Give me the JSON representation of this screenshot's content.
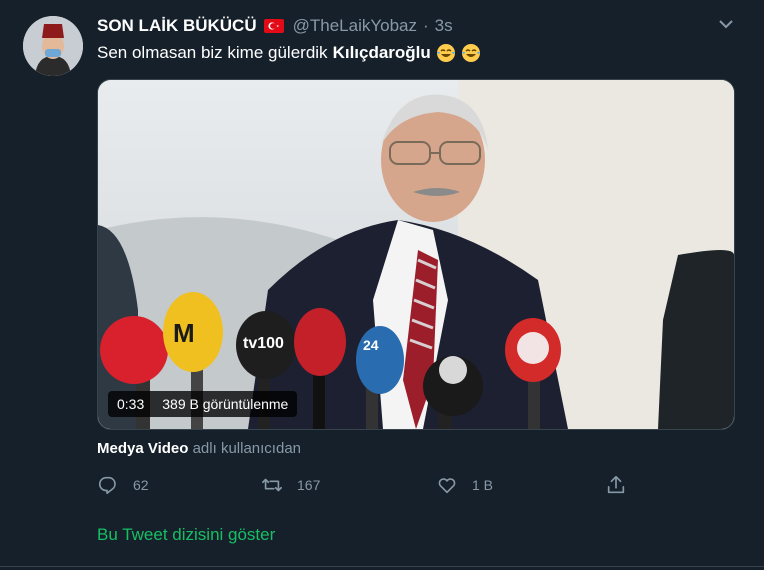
{
  "tweet": {
    "display_name": "SON LAİK BÜKÜCÜ",
    "flag_icon": "turkey-flag-emoji",
    "handle": "@TheLaikYobaz",
    "separator": "·",
    "time": "3s",
    "text_plain": "Sen olmasan biz kime gülerdik",
    "text_bold": "Kılıçdaroğlu",
    "emojis": [
      "face-with-tears-of-joy",
      "face-with-tears-of-joy"
    ]
  },
  "video": {
    "duration": "0:33",
    "views": "389 B görüntülenme",
    "mic_labels": [
      "tv100",
      "24"
    ]
  },
  "source": {
    "name": "Medya Video",
    "suffix": "adlı kullanıcıdan"
  },
  "actions": {
    "reply_count": "62",
    "retweet_count": "167",
    "like_count": "1 B"
  },
  "show_thread": "Bu Tweet dizisini göster",
  "colors": {
    "background": "#15202b",
    "secondary_text": "#8899a6",
    "thread_link": "#17bf63",
    "border": "#38444d"
  }
}
